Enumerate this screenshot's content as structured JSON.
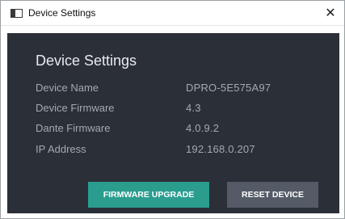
{
  "window": {
    "title": "Device Settings",
    "close_glyph": "✕"
  },
  "panel": {
    "heading": "Device Settings",
    "fields": [
      {
        "label": "Device Name",
        "value": "DPRO-5E575A97"
      },
      {
        "label": "Device Firmware",
        "value": "4.3"
      },
      {
        "label": "Dante Firmware",
        "value": "4.0.9.2"
      },
      {
        "label": "IP Address",
        "value": "192.168.0.207"
      }
    ],
    "buttons": {
      "firmware_upgrade": "FIRMWARE UPGRADE",
      "reset_device": "RESET DEVICE"
    }
  },
  "colors": {
    "panel_bg": "#2b2f37",
    "accent": "#2a9d8f",
    "secondary_button": "#545b66",
    "text_muted": "#a4a9b1"
  },
  "icons": {
    "app": "window-icon",
    "close": "close-icon"
  }
}
